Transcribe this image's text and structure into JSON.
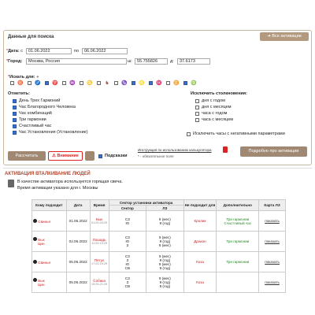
{
  "search": {
    "title": "Данные для поиска",
    "all_activations_button": "Все активации",
    "date_label": "Дата:",
    "date_from_prefix": "с",
    "date_from": "01.06.2022",
    "date_to_prefix": "по",
    "date_to": "06.06.2022",
    "city_label": "Город:",
    "city": "Москва, Россия",
    "lat_label": "ш:",
    "lat": "55.755826",
    "lon_label": "д:",
    "lon": "37.6173",
    "days_label": "Искать для:",
    "mark_label": "Отметить:",
    "mark_items": [
      {
        "label": "День Трех Гармоний",
        "checked": true
      },
      {
        "label": "Час Благородного Человека",
        "checked": true
      },
      {
        "label": "Час комбинаций",
        "checked": true
      },
      {
        "label": "Три гармонии",
        "checked": true
      },
      {
        "label": "Счастливый час",
        "checked": true
      },
      {
        "label": "Час Установления (Установление)",
        "checked": true
      }
    ],
    "exclude_label": "Исключить столкновения:",
    "exclude_items": [
      {
        "label": "дня с годом",
        "checked": false
      },
      {
        "label": "дня с месяцем",
        "checked": false
      },
      {
        "label": "часа с годом",
        "checked": false
      },
      {
        "label": "часа с месяцем",
        "checked": false
      }
    ],
    "exclude_negative": "Исключить часы с негативными параметрами",
    "calc_button": "Рассчитать",
    "warning_button": "Внимание",
    "extra_button": "",
    "hints_label": "Подсказки",
    "instruction_link": "Инструкция по использованию калькулятора",
    "required_note": "* - обязательное поле",
    "details_button": "Подробно про активации"
  },
  "results": {
    "section_title": "АКТИВАЦИЯ ВТАЛКИВАНИЕ ЛЮДЕЙ",
    "note_line1": "В качестве активатора используется горящая свеча.",
    "note_line2": "Время активации указано для г. Москвы",
    "headers": {
      "who": "Кому подходит",
      "date": "Дата",
      "time": "Время",
      "sector_group": "Сектор установки активатора",
      "sector": "Сектор",
      "lz": "ЛЗ",
      "not_fit": "Не подходит для",
      "extra": "Дополнительно",
      "map": "Карта ЛЗ"
    },
    "rows": [
      {
        "who1": "Свинья",
        "who2": "",
        "date": "01.06.2022",
        "time_animal": "Бык",
        "time_range": "01:29-03:29",
        "sectors": [
          {
            "s": "СЗ",
            "lz": "9 (мес)"
          },
          {
            "s": "Ю",
            "lz": "9 (год)"
          }
        ],
        "not_fit": "Кролик",
        "extra1": "Три гармонии",
        "extra2": "Счастливый час",
        "map": "показать"
      },
      {
        "who1": "Бык",
        "who2": "Цин",
        "date": "02.06.2022",
        "time_animal": "Лошадь",
        "time_range": "11:29-13:29",
        "sectors": [
          {
            "s": "СЗ",
            "lz": "9 (мес)"
          },
          {
            "s": "Ю",
            "lz": "9 (год)"
          },
          {
            "s": "З",
            "lz": "9 (мес)"
          }
        ],
        "not_fit": "Дракон",
        "extra1": "Три гармонии",
        "extra2": "",
        "map": "показать"
      },
      {
        "who1": "Свинья",
        "who2": "",
        "date": "05.06.2022",
        "time_animal": "Петух",
        "time_range": "17:29-19:29",
        "sectors": [
          {
            "s": "СЗ",
            "lz": "9 (мес)"
          },
          {
            "s": "З",
            "lz": "9 (год)"
          },
          {
            "s": "Ю",
            "lz": "9 (мес)"
          },
          {
            "s": "СВ",
            "lz": "9 (год)"
          }
        ],
        "not_fit": "Коза",
        "extra1": "Три гармонии",
        "extra2": "",
        "map": "показать"
      },
      {
        "who1": "Бык",
        "who2": "Цин",
        "date": "05.06.2022",
        "time_animal": "Собака",
        "time_range": "19:29-21:29",
        "sectors": [
          {
            "s": "СЗ",
            "lz": "9 (мес)"
          },
          {
            "s": "З",
            "lz": "9 (год)"
          },
          {
            "s": "СВ",
            "lz": "8 (год)"
          }
        ],
        "not_fit": "Коза",
        "extra1": "",
        "extra2": "",
        "map": "показать"
      }
    ]
  },
  "colors": {
    "accent": "#b39a7f",
    "title_red": "#b5462d",
    "green": "#2a8a2a"
  }
}
